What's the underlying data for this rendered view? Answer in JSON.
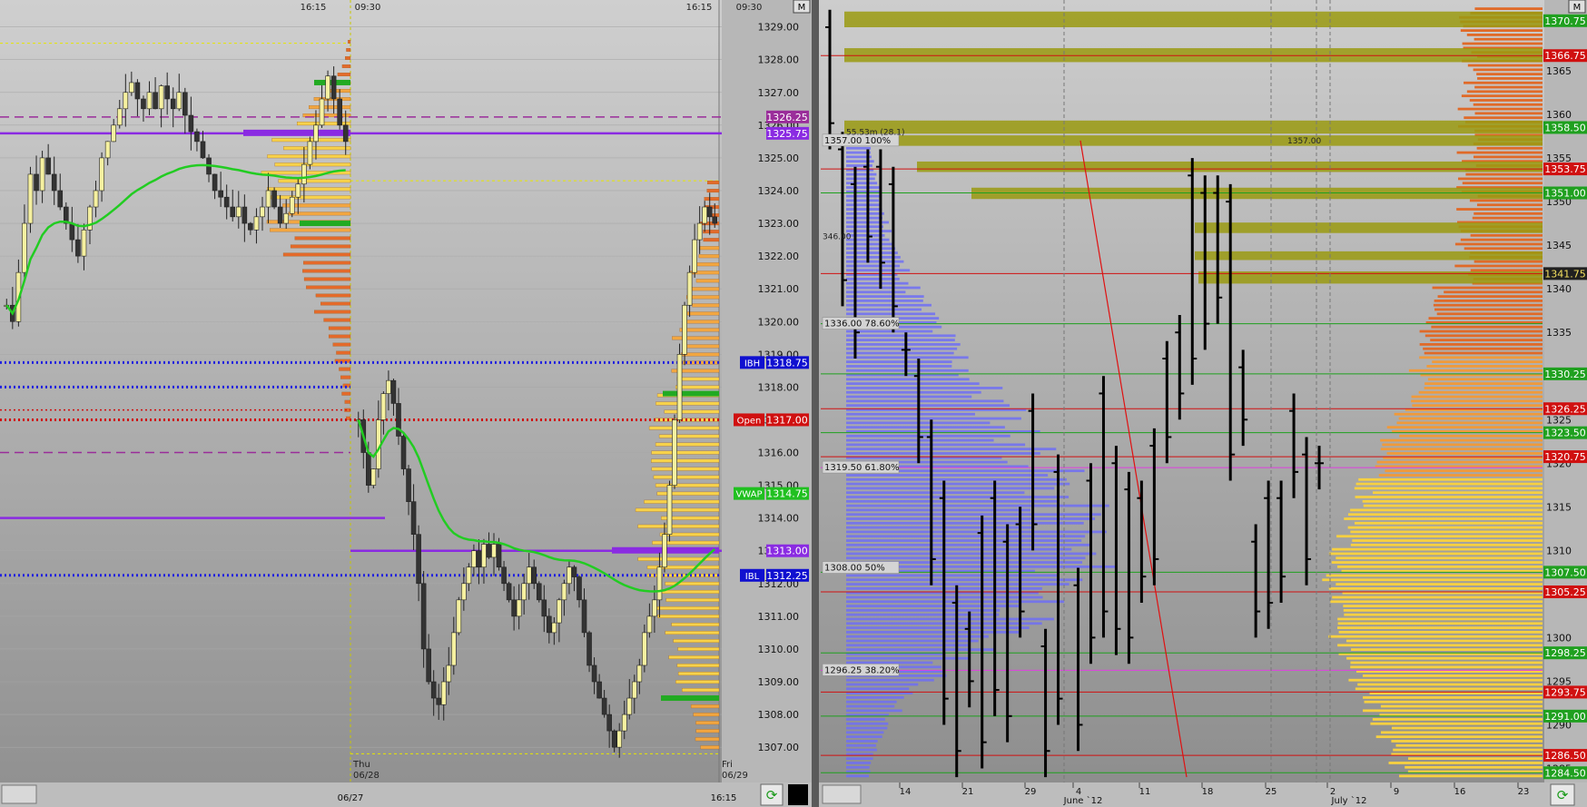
{
  "window": {
    "corner_label": "M"
  },
  "chart_data": [
    {
      "type": "candlestick",
      "panel": "left-intraday",
      "top_time_labels": [
        "16:15",
        "09:30",
        "16:15",
        "09:30"
      ],
      "bottom_labels": [
        "06/27",
        "16:15"
      ],
      "session_labels": [
        {
          "day": "Thu",
          "date": "06/28"
        },
        {
          "day": "Fri",
          "date": "06/29"
        }
      ],
      "y_ticks": [
        1329.0,
        1328.0,
        1327.0,
        1326.0,
        1325.0,
        1324.0,
        1323.0,
        1322.0,
        1321.0,
        1320.0,
        1319.0,
        1318.0,
        1317.0,
        1316.0,
        1315.0,
        1314.0,
        1313.0,
        1312.0,
        1311.0,
        1310.0,
        1309.0,
        1308.0,
        1307.0
      ],
      "ylim": [
        1306.2,
        1329.6
      ],
      "price_labels": [
        {
          "text": "1326.25",
          "value": 1326.25,
          "color": "#9a2d9a"
        },
        {
          "text": "1325.75",
          "value": 1325.75,
          "color": "#8a2be2"
        },
        {
          "text": "1318.75",
          "value": 1318.75,
          "color": "#1010d0",
          "tag": "IBH"
        },
        {
          "text": "1317.00",
          "value": 1317.0,
          "color": "#d01010",
          "tag": "Open"
        },
        {
          "text": "1314.75",
          "value": 1314.75,
          "color": "#20c020",
          "tag": "VWAP"
        },
        {
          "text": "1313.00",
          "value": 1313.0,
          "color": "#8a2be2"
        },
        {
          "text": "1312.25",
          "value": 1312.25,
          "color": "#1010d0",
          "tag": "IBL"
        }
      ],
      "levels": [
        {
          "value": 1325.75,
          "style": "solid",
          "color": "#8a2be2"
        },
        {
          "value": 1326.25,
          "style": "dashed",
          "color": "#9a2d9a"
        },
        {
          "value": 1318.75,
          "style": "dotted",
          "color": "#2020e0"
        },
        {
          "value": 1317.0,
          "style": "dotted",
          "color": "#d01010"
        },
        {
          "value": 1313.0,
          "style": "solid",
          "color": "#8a2be2"
        },
        {
          "value": 1312.25,
          "style": "dotted",
          "color": "#2020e0"
        }
      ],
      "session_1_close": [
        1320.5,
        1320.0,
        1321.5,
        1323.0,
        1324.5,
        1324.0,
        1325.0,
        1324.5,
        1324.0,
        1323.5,
        1323.0,
        1322.5,
        1322.0,
        1322.8,
        1323.5,
        1324.0,
        1325.0,
        1325.5,
        1326.0,
        1326.5,
        1327.0,
        1327.3,
        1326.8,
        1326.5,
        1327.0,
        1326.5,
        1327.2,
        1326.8,
        1326.5,
        1327.0,
        1326.3,
        1325.8,
        1325.5,
        1325.0,
        1324.5,
        1324.0,
        1323.8,
        1323.5,
        1323.2,
        1323.5,
        1323.0,
        1322.8,
        1323.2,
        1323.5,
        1324.0,
        1323.5,
        1323.0,
        1323.3,
        1323.8,
        1324.2,
        1324.8,
        1325.5,
        1326.0,
        1326.8,
        1327.5,
        1326.8,
        1326.0,
        1325.5
      ],
      "session_2_close": [
        1317.0,
        1316.0,
        1315.0,
        1315.5,
        1317.0,
        1317.8,
        1318.2,
        1317.5,
        1316.5,
        1315.5,
        1314.5,
        1313.5,
        1312.0,
        1310.0,
        1309.0,
        1308.5,
        1308.3,
        1309.0,
        1309.5,
        1310.5,
        1311.5,
        1312.0,
        1312.5,
        1313.0,
        1312.5,
        1313.2,
        1312.8,
        1313.2,
        1312.5,
        1312.0,
        1311.5,
        1311.0,
        1311.5,
        1312.0,
        1312.5,
        1312.0,
        1311.5,
        1311.0,
        1310.5,
        1310.8,
        1311.5,
        1312.0,
        1312.5,
        1312.2,
        1311.5,
        1310.5,
        1309.5,
        1309.0,
        1308.5,
        1308.0,
        1307.5,
        1307.0,
        1307.5,
        1308.0,
        1308.5,
        1309.0,
        1309.5,
        1310.5,
        1311.0,
        1311.5,
        1312.5,
        1313.5,
        1315.0,
        1317.0,
        1319.0,
        1320.5,
        1321.5,
        1322.5,
        1323.0,
        1323.5,
        1323.2,
        1323.0
      ]
    },
    {
      "type": "bar",
      "panel": "right-daily",
      "x_ticks": [
        "14",
        "21",
        "29",
        "4",
        "11",
        "18",
        "25",
        "2",
        "9",
        "16",
        "23"
      ],
      "month_labels": [
        "June `12",
        "July `12"
      ],
      "y_ticks": [
        1365,
        1360,
        1355,
        1350,
        1345,
        1340,
        1335,
        1330,
        1325,
        1320,
        1315,
        1310,
        1305,
        1300,
        1295,
        1290,
        1285
      ],
      "ylim": [
        1283.8,
        1372.5
      ],
      "fib_levels": [
        {
          "text": "1357.00 100%",
          "value": 1357.0
        },
        {
          "text": "1336.00 78.60%",
          "value": 1336.0
        },
        {
          "text": "1319.50 61.80%",
          "value": 1319.5
        },
        {
          "text": "1308.00 50%",
          "value": 1308.0
        },
        {
          "text": "1296.25 38.20%",
          "value": 1296.25
        }
      ],
      "annotations": [
        {
          "text": "1357.00",
          "value": 1357.0
        },
        {
          "text": "346.00",
          "value": 1346.0
        },
        {
          "text": "55.53m (28.1)",
          "value": 1358.0
        }
      ],
      "price_labels": [
        {
          "text": "1370.75",
          "value": 1370.75,
          "color": "#1fa01f"
        },
        {
          "text": "1366.75",
          "value": 1366.75,
          "color": "#d01010"
        },
        {
          "text": "1358.50",
          "value": 1358.5,
          "color": "#1fa01f"
        },
        {
          "text": "1353.75",
          "value": 1353.75,
          "color": "#d01010"
        },
        {
          "text": "1351.00",
          "value": 1351.0,
          "color": "#1fa01f"
        },
        {
          "text": "1341.75",
          "value": 1341.75,
          "color": "#202020"
        },
        {
          "text": "1330.25",
          "value": 1330.25,
          "color": "#1fa01f"
        },
        {
          "text": "1326.25",
          "value": 1326.25,
          "color": "#d01010"
        },
        {
          "text": "1323.50",
          "value": 1323.5,
          "color": "#1fa01f"
        },
        {
          "text": "1320.75",
          "value": 1320.75,
          "color": "#d01010"
        },
        {
          "text": "1307.50",
          "value": 1307.5,
          "color": "#1fa01f"
        },
        {
          "text": "1305.25",
          "value": 1305.25,
          "color": "#d01010"
        },
        {
          "text": "1298.25",
          "value": 1298.25,
          "color": "#1fa01f"
        },
        {
          "text": "1293.75",
          "value": 1293.75,
          "color": "#d01010"
        },
        {
          "text": "1291.00",
          "value": 1291.0,
          "color": "#1fa01f"
        },
        {
          "text": "1286.50",
          "value": 1286.5,
          "color": "#d01010"
        },
        {
          "text": "1284.50",
          "value": 1284.5,
          "color": "#1fa01f"
        }
      ],
      "ohlc_bars": [
        [
          1372,
          1356
        ],
        [
          1358,
          1338
        ],
        [
          1354,
          1332
        ],
        [
          1356,
          1343
        ],
        [
          1356,
          1340
        ],
        [
          1354,
          1335
        ],
        [
          1335,
          1330
        ],
        [
          1332,
          1320
        ],
        [
          1325,
          1306
        ],
        [
          1318,
          1290
        ],
        [
          1306,
          1284
        ],
        [
          1303,
          1292
        ],
        [
          1314,
          1285
        ],
        [
          1318,
          1291
        ],
        [
          1313,
          1288
        ],
        [
          1315,
          1300
        ],
        [
          1328,
          1310
        ],
        [
          1301,
          1284
        ],
        [
          1321,
          1290
        ],
        [
          1308,
          1287
        ],
        [
          1320,
          1297
        ],
        [
          1330,
          1300
        ],
        [
          1322,
          1298
        ],
        [
          1319,
          1297
        ],
        [
          1318,
          1304
        ],
        [
          1324,
          1306
        ],
        [
          1334,
          1320
        ],
        [
          1337,
          1325
        ],
        [
          1355,
          1329
        ],
        [
          1353,
          1333
        ],
        [
          1353,
          1336
        ],
        [
          1352,
          1318
        ],
        [
          1333,
          1322
        ],
        [
          1313,
          1300
        ],
        [
          1318,
          1301
        ],
        [
          1318,
          1304
        ],
        [
          1328,
          1316
        ],
        [
          1323,
          1306
        ],
        [
          1322,
          1317
        ]
      ],
      "h_lines": [
        {
          "value": 1366.75,
          "color": "#d01010"
        },
        {
          "value": 1353.75,
          "color": "#d01010"
        },
        {
          "value": 1351.0,
          "color": "#1fa01f"
        },
        {
          "value": 1341.75,
          "color": "#d01010"
        },
        {
          "value": 1336.0,
          "color": "#1fa01f"
        },
        {
          "value": 1330.25,
          "color": "#1fa01f"
        },
        {
          "value": 1326.25,
          "color": "#d01010"
        },
        {
          "value": 1323.5,
          "color": "#1fa01f"
        },
        {
          "value": 1320.75,
          "color": "#d01010"
        },
        {
          "value": 1319.5,
          "color": "#e040e0"
        },
        {
          "value": 1307.5,
          "color": "#1fa01f"
        },
        {
          "value": 1305.25,
          "color": "#d01010"
        },
        {
          "value": 1298.25,
          "color": "#1fa01f"
        },
        {
          "value": 1296.25,
          "color": "#e040e0"
        },
        {
          "value": 1293.75,
          "color": "#d01010"
        },
        {
          "value": 1291.0,
          "color": "#1fa01f"
        },
        {
          "value": 1286.5,
          "color": "#d01010"
        },
        {
          "value": 1284.5,
          "color": "#1fa01f"
        }
      ],
      "zones": [
        [
          1370.0,
          1371.8
        ],
        [
          1366.0,
          1367.6
        ],
        [
          1357.8,
          1359.3
        ],
        [
          1356.4,
          1357.6
        ],
        [
          1353.4,
          1354.6
        ],
        [
          1350.3,
          1351.6
        ],
        [
          1346.4,
          1347.6
        ],
        [
          1343.3,
          1344.3
        ],
        [
          1340.6,
          1342.0
        ]
      ]
    }
  ]
}
